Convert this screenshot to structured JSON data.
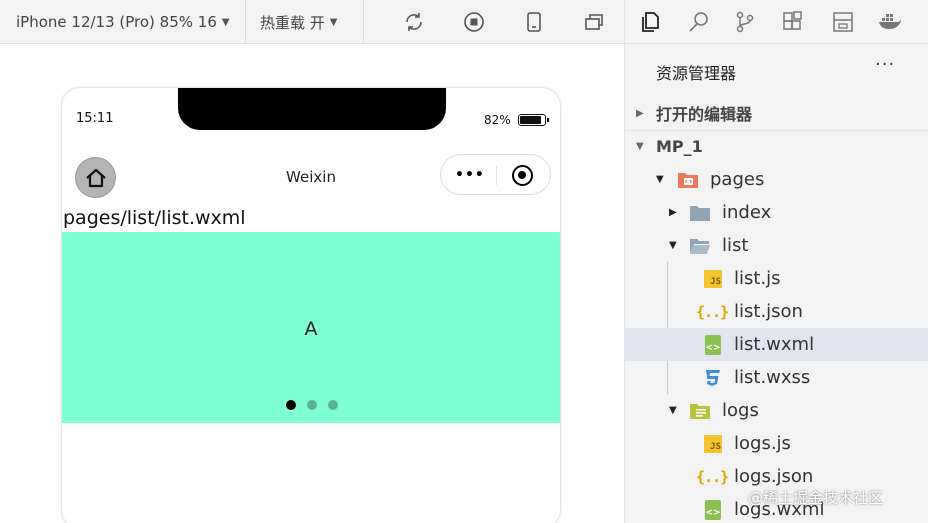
{
  "toolbar": {
    "device_select": "iPhone 12/13 (Pro) 85% 16",
    "hot_reload_select": "热重载 开",
    "icons": [
      "refresh-icon",
      "stop-icon",
      "phone-icon",
      "window-icon"
    ]
  },
  "phone": {
    "time": "15:11",
    "battery_text": "82%",
    "battery_level": 0.82,
    "nav_title": "Weixin",
    "capsule_dots": "•••",
    "page_path": "pages/list/list.wxml",
    "swiper": {
      "text": "A",
      "background": "#7fffd4",
      "dot_count": 3,
      "active_dot": 0
    }
  },
  "activity_bar": {
    "icons": [
      "explorer-icon",
      "search-icon",
      "source-control-icon",
      "extensions-icon",
      "layout-icon",
      "docker-icon"
    ]
  },
  "explorer": {
    "title": "资源管理器",
    "more": "···",
    "open_editors": "打开的编辑器",
    "project": "MP_1",
    "tree": {
      "pages": "pages",
      "index": "index",
      "list": "list",
      "list_js": "list.js",
      "list_json": "list.json",
      "list_wxml": "list.wxml",
      "list_wxss": "list.wxss",
      "logs": "logs",
      "logs_js": "logs.js",
      "logs_json": "logs.json",
      "logs_wxml": "logs.wxml"
    },
    "icon_labels": {
      "js": "JS",
      "json": "{..}",
      "wxml": "<>"
    }
  },
  "watermark": "@稀土掘金技术社区",
  "colors": {
    "selected_row": "#e2e4ef",
    "swiper_bg": "#7fffd4",
    "js_icon": "#f3c42f",
    "wxml_icon": "#8cc152",
    "wxss_icon": "#3a8fd9",
    "folder": "#8fa3b3"
  }
}
